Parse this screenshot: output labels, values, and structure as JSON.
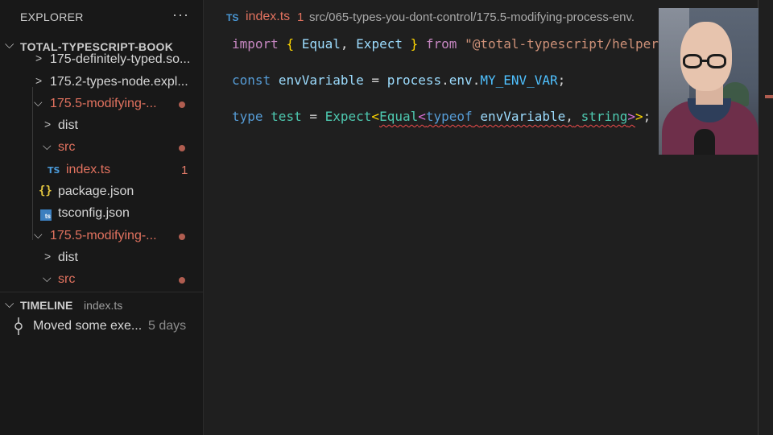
{
  "sidebar": {
    "explorer_title": "EXPLORER",
    "more_actions": "···",
    "section_title": "TOTAL-TYPESCRIPT-BOOK",
    "tree": [
      {
        "label": "175-definitely-typed.so...",
        "kind": "folder",
        "expanded": false,
        "modified": false
      },
      {
        "label": "175.2-types-node.expl...",
        "kind": "folder",
        "expanded": false,
        "modified": false
      },
      {
        "label": "175.5-modifying-...",
        "kind": "folder",
        "expanded": true,
        "modified": true
      },
      {
        "label": "dist",
        "kind": "folder",
        "expanded": false,
        "modified": false
      },
      {
        "label": "src",
        "kind": "folder",
        "expanded": true,
        "modified": true
      },
      {
        "label": "index.ts",
        "kind": "ts-file",
        "problems": "1",
        "modified": true,
        "icon_text": "TS"
      },
      {
        "label": "package.json",
        "kind": "json-file",
        "icon_text": "{}"
      },
      {
        "label": "tsconfig.json",
        "kind": "tsconfig-file",
        "icon_text": "ts"
      },
      {
        "label": "175.5-modifying-...",
        "kind": "folder",
        "expanded": true,
        "modified": true
      },
      {
        "label": "dist",
        "kind": "folder",
        "expanded": false,
        "modified": false
      },
      {
        "label": "src",
        "kind": "folder",
        "expanded": true,
        "modified": true
      }
    ],
    "timeline": {
      "title": "TIMELINE",
      "file": "index.ts",
      "entry_message": "Moved some exe...",
      "entry_age": "5 days"
    }
  },
  "editor": {
    "breadcrumb": {
      "file_icon": "TS",
      "file_name": "index.ts",
      "problem_count": "1",
      "path": "src/065-types-you-dont-control/175.5-modifying-process-env."
    },
    "code": {
      "line1": {
        "import_kw": "import",
        "open_brace": "{",
        "name1": "Equal",
        "comma1": ",",
        "name2": "Expect",
        "close_brace": "}",
        "from_kw": "from",
        "module": "\"@total-typescript/helpers\"",
        "semi": ";"
      },
      "line2": {
        "const_kw": "const",
        "var_name": "envVariable",
        "eq": "=",
        "object": "process",
        "dot1": ".",
        "prop": "env",
        "dot2": ".",
        "env_key": "MY_ENV_VAR",
        "semi": ";"
      },
      "line3": {
        "type_kw": "type",
        "alias": "test",
        "eq": "=",
        "expect": "Expect",
        "lt1": "<",
        "equal": "Equal",
        "lt2": "<",
        "typeof_kw": "typeof",
        "var_ref": "envVariable",
        "comma": ",",
        "string_kw": "string",
        "gt2": ">",
        "gt1": ">",
        "semi": ";"
      }
    }
  },
  "colors": {
    "modified": "#e2725f",
    "error_squiggle": "#f14c4c",
    "ts_blue": "#4a9ad9"
  }
}
